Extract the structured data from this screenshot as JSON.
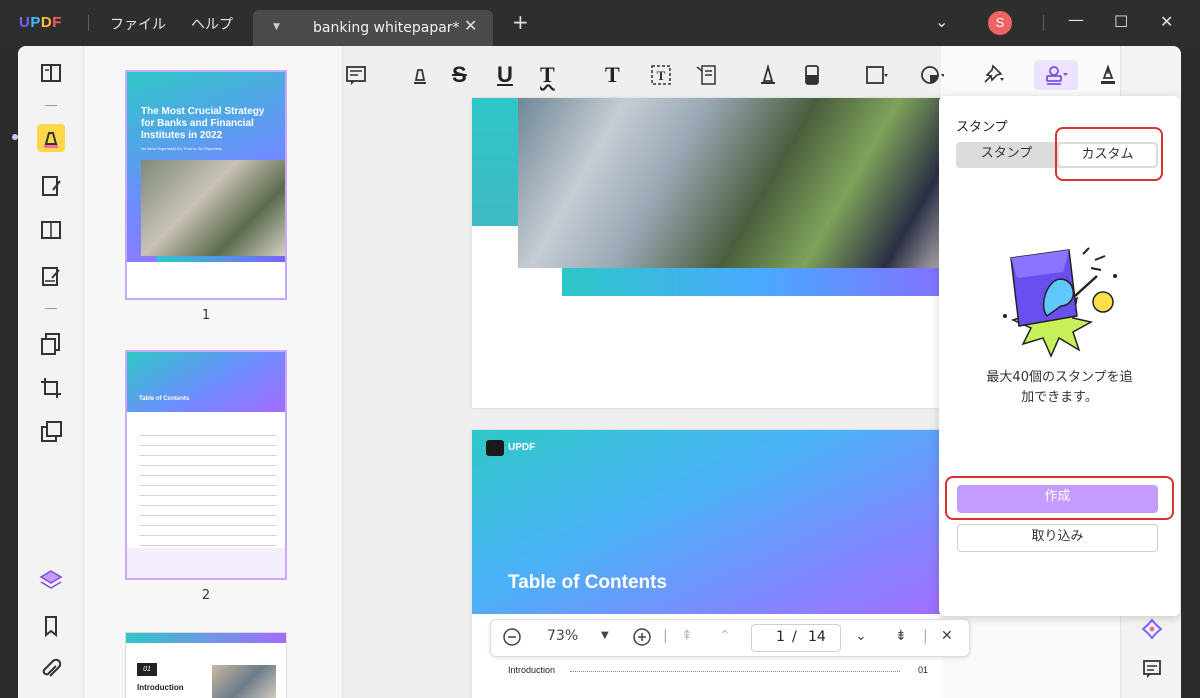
{
  "app": {
    "logo": [
      "U",
      "P",
      "D",
      "F"
    ],
    "menu_file": "ファイル",
    "menu_help": "ヘルプ",
    "tab_title": "banking whitepapar*",
    "avatar_letter": "S"
  },
  "thumbnails": {
    "page1": {
      "number": "1",
      "title": "The Most Crucial Strategy for Banks and Financial Institutes in 2022",
      "subtitle": "No More Expenses! It's Time to Go Paperless"
    },
    "page2": {
      "number": "2",
      "title": "Table of Contents"
    },
    "page3": {
      "number_label": "01",
      "title": "Introduction"
    }
  },
  "document": {
    "brand": "UPDF",
    "toc_title": "Table of Contents",
    "toc_first_entry": "Introduction",
    "toc_first_page": "01"
  },
  "stamp_panel": {
    "title": "スタンプ",
    "tab_stamp": "スタンプ",
    "tab_custom": "カスタム",
    "description_line1": "最大40個のスタンプを追",
    "description_line2": "加できます。",
    "create_label": "作成",
    "import_label": "取り込み"
  },
  "zoom_bar": {
    "zoom": "73%",
    "current_page": "1",
    "separator": "/",
    "total_pages": "14"
  },
  "colors": {
    "accent": "#c49bff",
    "highlight": "#d93030",
    "active_tool": "#ffd84a"
  }
}
